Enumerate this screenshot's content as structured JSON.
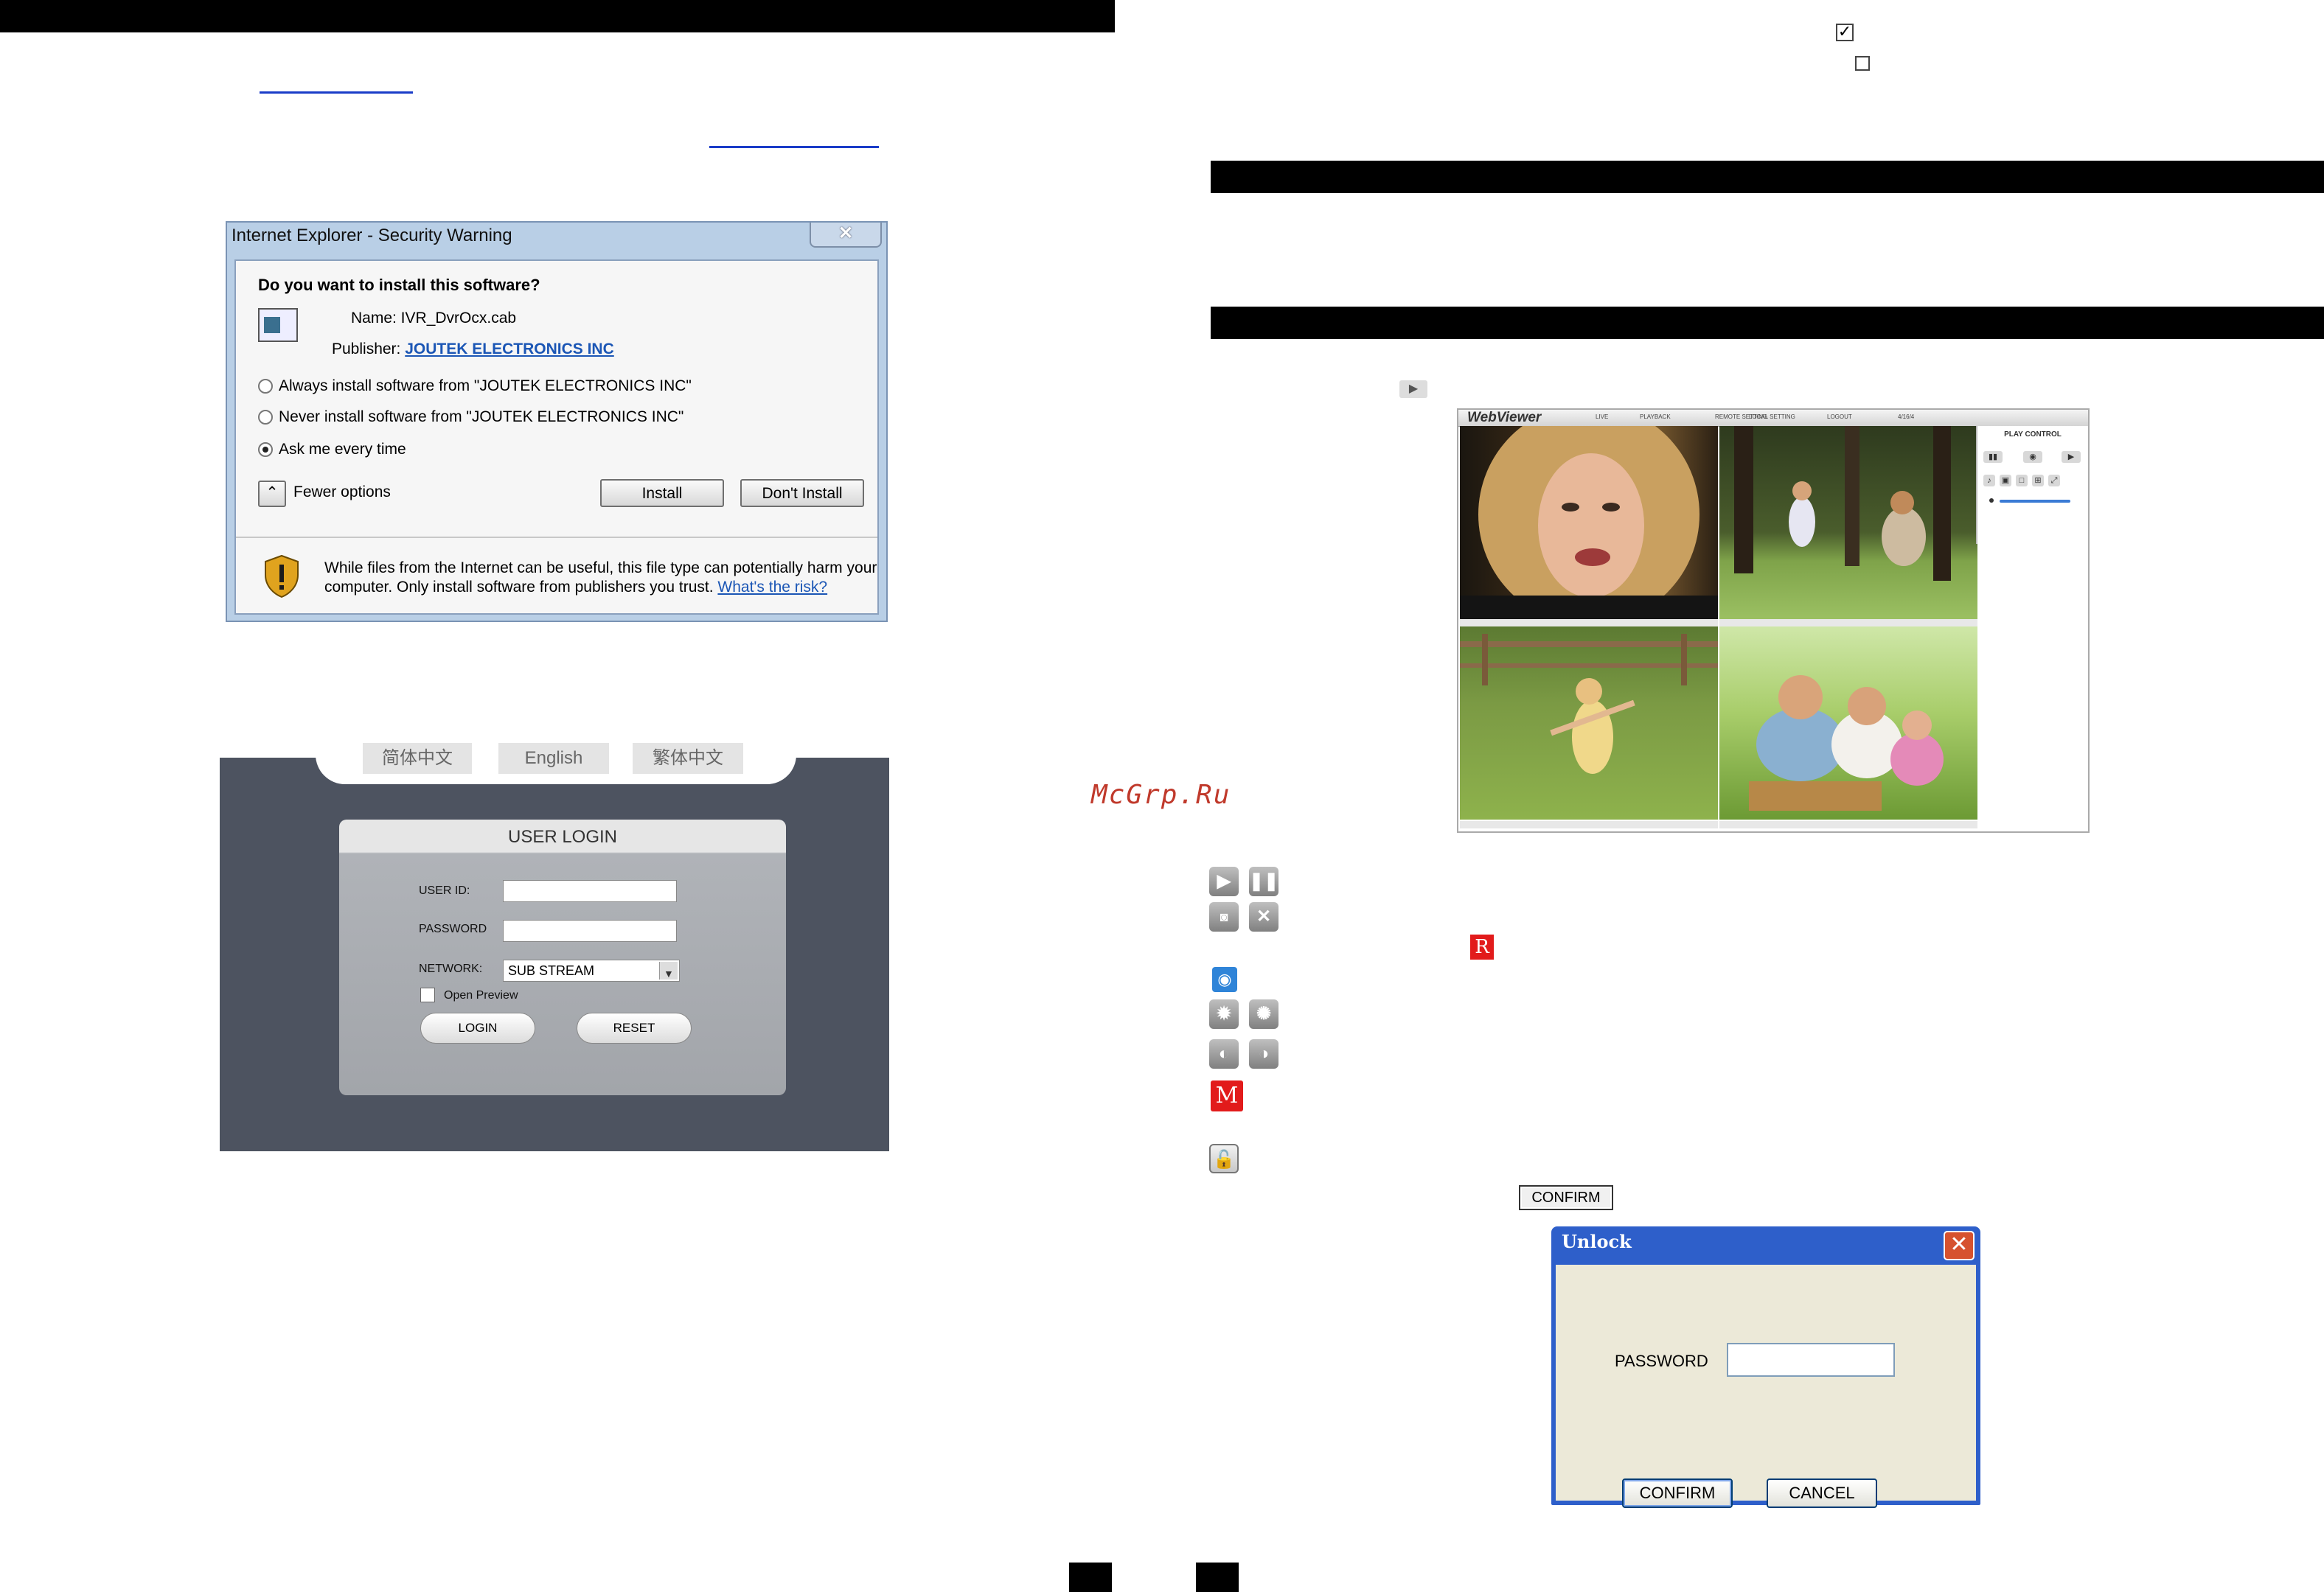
{
  "left_page": {
    "ie_dialog": {
      "title": "Internet Explorer - Security Warning",
      "close": "✕",
      "question": "Do you want to install this software?",
      "name": "Name:  IVR_DvrOcx.cab",
      "publisher_label": "Publisher:",
      "publisher": "JOUTEK ELECTRONICS INC",
      "options": [
        "Always install software from \"JOUTEK ELECTRONICS INC\"",
        "Never install software from \"JOUTEK ELECTRONICS INC\"",
        "Ask me every time"
      ],
      "selected_option_index": 2,
      "fewer_options": "Fewer options",
      "install": "Install",
      "dont_install": "Don't Install",
      "warning": "While files from the Internet can be useful, this file type can potentially harm your computer. Only install software from publishers you trust.",
      "risk_link": "What's the risk?"
    },
    "login": {
      "languages": [
        "简体中文",
        "English",
        "繁体中文"
      ],
      "title": "USER LOGIN",
      "user_id_label": "USER ID:",
      "password_label": "PASSWORD",
      "network_label": "NETWORK:",
      "network_value": "SUB STREAM",
      "open_preview": "Open Preview",
      "login_button": "LOGIN",
      "reset_button": "RESET"
    }
  },
  "right_page": {
    "watermark": "McGrp.Ru",
    "webviewer": {
      "logo": "WebViewer",
      "menu": [
        "LIVE",
        "PLAYBACK",
        "REMOTE SETTING",
        "LOCAL SETTING",
        "LOGOUT",
        "4/16/4"
      ],
      "side_title": "PLAY CONTROL"
    },
    "icon_labels": {
      "record": "R",
      "manual": "M"
    },
    "confirm_small": "CONFIRM",
    "unlock_dialog": {
      "title": "Unlock",
      "password_label": "PASSWORD",
      "confirm": "CONFIRM",
      "cancel": "CANCEL"
    }
  }
}
